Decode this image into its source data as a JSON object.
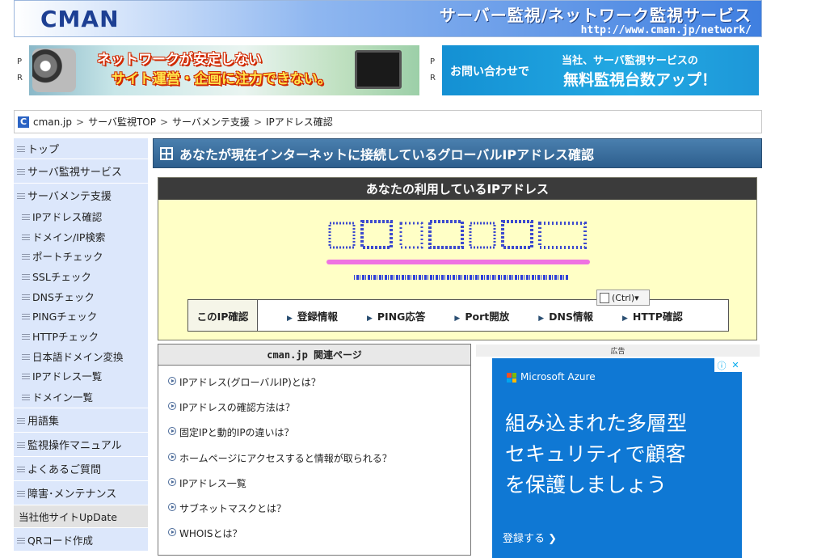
{
  "header": {
    "logo": "CMAN",
    "tagline": "サーバー監視/ネットワーク監視サービス",
    "url": "http://www.cman.jp/network/"
  },
  "ads_top": {
    "pr_label_1": "P",
    "pr_label_2": "R",
    "banner1_line1": "ネットワークが安定しない",
    "banner1_line2": "サイト運営・企画に注力できない。",
    "banner2_left": "お問い合わせで",
    "banner2_right_top": "当社、サーバ監視サービスの",
    "banner2_right_bottom": "無料監視台数アップ！"
  },
  "breadcrumb": {
    "icon": "C",
    "items": [
      "cman.jp",
      "サーバ監視TOP",
      "サーバメンテ支援",
      "IPアドレス確認"
    ],
    "separator": ">"
  },
  "sidebar": {
    "top_items": [
      "トップ",
      "サーバ監視サービス"
    ],
    "maint_label": "サーバメンテ支援",
    "maint_sub": [
      "IPアドレス確認",
      "ドメイン/IP検索",
      "ポートチェック",
      "SSLチェック",
      "DNSチェック",
      "PINGチェック",
      "HTTPチェック",
      "日本語ドメイン変換",
      "IPアドレス一覧",
      "ドメイン一覧"
    ],
    "bottom_items": [
      "用語集",
      "監視操作マニュアル",
      "よくあるご質問",
      "障害･メンテナンス"
    ],
    "update_label": "当社他サイトUpDate",
    "qr_label": "QRコード作成"
  },
  "main": {
    "title": "あなたが現在インターネットに接続しているグローバルIPアドレス確認",
    "ipbox_head": "あなたの利用しているIPアドレス",
    "confirm_label": "このIP確認",
    "confirm_links": [
      "登録情報",
      "PING応答",
      "Port開放",
      "DNS情報",
      "HTTP確認"
    ],
    "ctrl_popup": "(Ctrl)▾"
  },
  "related": {
    "heading": "cman.jp 関連ページ",
    "items": [
      "IPアドレス(グローバルIP)とは？",
      "IPアドレスの確認方法は？",
      "固定IPと動的IPの違いは？",
      "ホームページにアクセスすると情報が取られる？",
      "IPアドレス一覧",
      "サブネットマスクとは？",
      "WHOISとは？"
    ]
  },
  "ad": {
    "label": "広告",
    "brand": "Microsoft Azure",
    "headline_lines": [
      "組み込まれた多層型",
      "セキュリティで顧客",
      "を保護しましょう"
    ],
    "cta": "登録する ❯",
    "info_icon": "ⓘ",
    "close_icon": "✕"
  },
  "colors": {
    "sidebar_bg": "#dce7fb",
    "title_bg": "#3b6d9c",
    "ipbox_bg": "#ffffc6",
    "ad_bg": "#0f78d4",
    "captcha_line": "#ef73e2"
  }
}
